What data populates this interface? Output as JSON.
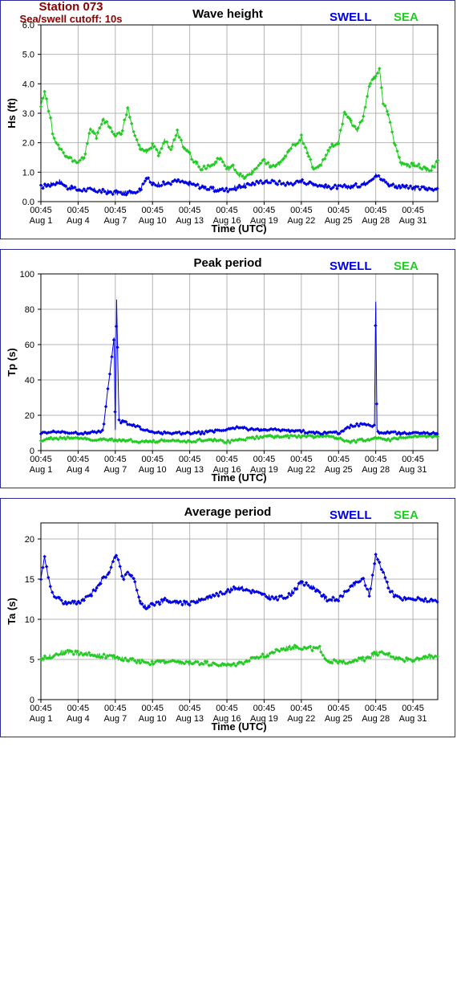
{
  "station": {
    "name": "Station 073",
    "cutoff": "Sea/swell cutoff: 10s"
  },
  "legend": {
    "swell": "SWELL",
    "sea": "SEA"
  },
  "colors": {
    "swell": "#0000e6",
    "sea": "#22cc22",
    "grid": "#b4b4b4",
    "frame": "#2d2d9a",
    "station": "#8b0000"
  },
  "x_axis": {
    "label": "Time (UTC)",
    "ticks": [
      {
        "day": 1,
        "time": "00:45",
        "date": "Aug 1"
      },
      {
        "day": 4,
        "time": "00:45",
        "date": "Aug 4"
      },
      {
        "day": 7,
        "time": "00:45",
        "date": "Aug 7"
      },
      {
        "day": 10,
        "time": "00:45",
        "date": "Aug 10"
      },
      {
        "day": 13,
        "time": "00:45",
        "date": "Aug 13"
      },
      {
        "day": 16,
        "time": "00:45",
        "date": "Aug 16"
      },
      {
        "day": 19,
        "time": "00:45",
        "date": "Aug 19"
      },
      {
        "day": 22,
        "time": "00:45",
        "date": "Aug 22"
      },
      {
        "day": 25,
        "time": "00:45",
        "date": "Aug 25"
      },
      {
        "day": 28,
        "time": "00:45",
        "date": "Aug 28"
      },
      {
        "day": 31,
        "time": "00:45",
        "date": "Aug 31"
      }
    ],
    "xlim": [
      1,
      33
    ]
  },
  "chart_data": [
    {
      "type": "line",
      "title": "Wave height",
      "ylabel": "Hs (ft)",
      "ylim": [
        0,
        6
      ],
      "yticks": [
        "0.0",
        "1.0",
        "2.0",
        "3.0",
        "4.0",
        "5.0",
        "6.0"
      ],
      "grid": true,
      "legend": "top-right",
      "series": [
        {
          "name": "SWELL",
          "x": [
            1,
            1.5,
            2,
            2.5,
            3,
            3.5,
            4,
            5,
            6,
            7,
            8,
            9,
            9.5,
            10,
            11,
            12,
            13,
            14,
            15,
            16,
            17,
            18,
            19,
            20,
            21,
            22,
            23,
            24,
            25,
            26,
            27,
            28,
            28.5,
            29,
            30,
            31,
            32,
            33
          ],
          "y": [
            0.5,
            0.55,
            0.6,
            0.7,
            0.5,
            0.45,
            0.4,
            0.4,
            0.35,
            0.3,
            0.3,
            0.4,
            0.8,
            0.6,
            0.6,
            0.7,
            0.6,
            0.5,
            0.4,
            0.4,
            0.5,
            0.6,
            0.7,
            0.65,
            0.6,
            0.7,
            0.6,
            0.5,
            0.5,
            0.5,
            0.6,
            0.9,
            0.75,
            0.6,
            0.5,
            0.45,
            0.45,
            0.45
          ]
        },
        {
          "name": "SEA",
          "x": [
            1,
            1.3,
            1.7,
            2,
            2.5,
            3,
            4,
            4.5,
            5,
            5.5,
            6,
            6.5,
            7,
            7.5,
            8,
            8.5,
            9,
            9.5,
            10,
            10.5,
            11,
            11.5,
            12,
            12.5,
            13,
            13.5,
            14,
            15,
            15.5,
            16,
            16.5,
            17,
            17.5,
            18,
            19,
            19.5,
            20,
            20.5,
            21,
            21.5,
            22,
            22.5,
            23,
            23.5,
            24,
            24.5,
            25,
            25.5,
            26,
            26.5,
            27,
            27.5,
            28,
            28.3,
            28.6,
            29,
            29.5,
            30,
            30.5,
            31,
            31.5,
            32,
            32.5,
            33
          ],
          "y": [
            3.3,
            3.7,
            3.0,
            2.2,
            1.8,
            1.6,
            1.3,
            1.5,
            2.5,
            2.2,
            2.8,
            2.6,
            2.2,
            2.3,
            3.2,
            2.3,
            1.8,
            1.7,
            1.9,
            1.6,
            2.1,
            1.8,
            2.4,
            1.9,
            1.6,
            1.3,
            1.1,
            1.3,
            1.5,
            1.1,
            1.2,
            0.9,
            0.8,
            1.0,
            1.4,
            1.2,
            1.2,
            1.4,
            1.8,
            1.9,
            2.2,
            1.7,
            1.1,
            1.2,
            1.6,
            1.9,
            2.0,
            3.1,
            2.7,
            2.4,
            2.9,
            4.0,
            4.3,
            4.5,
            3.3,
            3.0,
            2.0,
            1.3,
            1.2,
            1.3,
            1.2,
            1.1,
            1.1,
            1.4
          ]
        }
      ]
    },
    {
      "type": "line",
      "title": "Peak period",
      "ylabel": "Tp (s)",
      "ylim": [
        0,
        100
      ],
      "yticks": [
        "0",
        "20",
        "40",
        "60",
        "80",
        "100"
      ],
      "grid": true,
      "legend": "top-right",
      "series": [
        {
          "name": "SWELL",
          "x": [
            1,
            2,
            3,
            4,
            5,
            6,
            6.9,
            7,
            7.1,
            7.3,
            7.5,
            7.7,
            8,
            9,
            10,
            11,
            12,
            13,
            14,
            15,
            16,
            17,
            18,
            19,
            20,
            21,
            22,
            23,
            24,
            25,
            26,
            27,
            27.9,
            28,
            28.1,
            28.3,
            29,
            30,
            31,
            32,
            33
          ],
          "y": [
            10,
            11,
            10,
            10,
            10,
            11,
            64,
            12,
            85,
            17,
            16,
            17,
            15,
            13,
            10,
            10,
            10,
            10,
            10,
            11,
            12,
            13,
            12,
            12,
            12,
            11,
            11,
            10,
            10,
            10,
            14,
            15,
            14,
            85,
            12,
            10,
            10,
            10,
            10,
            10,
            10
          ]
        },
        {
          "name": "SEA",
          "x": [
            1,
            2,
            3,
            4,
            5,
            6,
            7,
            8,
            9,
            10,
            11,
            12,
            13,
            14,
            15,
            16,
            17,
            18,
            19,
            20,
            21,
            22,
            23,
            24,
            25,
            26,
            27,
            28,
            29,
            30,
            31,
            32,
            33
          ],
          "y": [
            6,
            7,
            7,
            7,
            6,
            6,
            6,
            6,
            5,
            5,
            6,
            5,
            5,
            6,
            6,
            5,
            6,
            7,
            8,
            8,
            8,
            8,
            8,
            8,
            7,
            5,
            6,
            7,
            6,
            7,
            8,
            8,
            8
          ]
        }
      ]
    },
    {
      "type": "line",
      "title": "Average period",
      "ylabel": "Ta (s)",
      "ylim": [
        0,
        22
      ],
      "yticks": [
        "0",
        "5",
        "10",
        "15",
        "20"
      ],
      "grid": true,
      "legend": "top-right",
      "series": [
        {
          "name": "SWELL",
          "x": [
            1,
            1.3,
            1.6,
            2,
            2.5,
            3,
            4,
            5,
            5.5,
            6,
            6.5,
            7,
            7.3,
            7.6,
            8,
            8.5,
            9,
            9.5,
            10,
            10.5,
            11,
            12,
            13,
            14,
            15,
            16,
            17,
            18,
            19,
            20,
            21,
            22,
            23,
            24,
            25,
            26,
            27,
            27.5,
            28,
            28.3,
            28.6,
            29,
            29.5,
            30,
            31,
            32,
            33
          ],
          "y": [
            15,
            18,
            15,
            13,
            12.5,
            12,
            12,
            13,
            14,
            15,
            16,
            18,
            17,
            15,
            16,
            15,
            12,
            11.5,
            12,
            12,
            12.5,
            12,
            12,
            12.5,
            13,
            13.5,
            14,
            13.5,
            13,
            12.5,
            13,
            14.5,
            14,
            12.5,
            12.5,
            14,
            15,
            13,
            18,
            17,
            16,
            14,
            13,
            12.5,
            12.5,
            12.5,
            12
          ]
        },
        {
          "name": "SEA",
          "x": [
            1,
            2,
            3,
            4,
            5,
            6,
            7,
            8,
            9,
            10,
            11,
            12,
            13,
            14,
            15,
            16,
            17,
            18,
            19,
            20,
            21,
            22,
            23,
            23.5,
            24,
            25,
            26,
            27,
            28,
            29,
            30,
            31,
            32,
            33
          ],
          "y": [
            5,
            5.5,
            6,
            5.8,
            5.6,
            5.5,
            5.2,
            5,
            4.8,
            4.5,
            4.8,
            4.6,
            4.5,
            4.6,
            4.4,
            4.2,
            4.5,
            5,
            5.5,
            6,
            6.5,
            6.5,
            6.3,
            6.4,
            5,
            4.6,
            4.8,
            5,
            5.8,
            5.6,
            5,
            5,
            5.2,
            5.5
          ]
        }
      ]
    }
  ]
}
